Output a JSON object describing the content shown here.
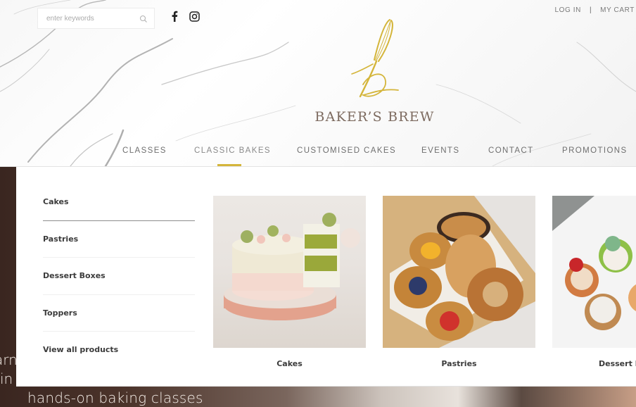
{
  "header": {
    "search": {
      "placeholder": "enter keywords",
      "value": ""
    },
    "social": [
      {
        "name": "facebook",
        "icon": "facebook-icon"
      },
      {
        "name": "instagram",
        "icon": "instagram-icon"
      }
    ],
    "account_links": {
      "login": "LOG IN",
      "separator": "|",
      "cart": "MY CART"
    },
    "logo": {
      "text": "BAKER’S BREW",
      "mark": "whisk-b-monogram",
      "mark_color": "#d4b53a"
    }
  },
  "nav": {
    "items": [
      {
        "label": "CLASSES",
        "active": false
      },
      {
        "label": "CLASSIC BAKES",
        "active": true
      },
      {
        "label": "CUSTOMISED CAKES",
        "active": false
      },
      {
        "label": "EVENTS",
        "active": false
      },
      {
        "label": "CONTACT",
        "active": false
      },
      {
        "label": "PROMOTIONS",
        "active": false
      }
    ],
    "accent_color": "#d4b53a"
  },
  "dropdown": {
    "menu": [
      {
        "label": "Cakes",
        "active": true
      },
      {
        "label": "Pastries",
        "active": false
      },
      {
        "label": "Dessert Boxes",
        "active": false
      },
      {
        "label": "Toppers",
        "active": false
      },
      {
        "label": "View all products",
        "active": false
      }
    ],
    "cards": [
      {
        "label": "Cakes",
        "image": "pistachio layer cake with macarons"
      },
      {
        "label": "Pastries",
        "image": "box of danish pastries and croissants"
      },
      {
        "label": "Dessert Boxes",
        "image": "box of decorated cupcakes"
      }
    ]
  },
  "hero": {
    "lines": [
      "arn",
      "in",
      "hands-on baking classes"
    ]
  }
}
